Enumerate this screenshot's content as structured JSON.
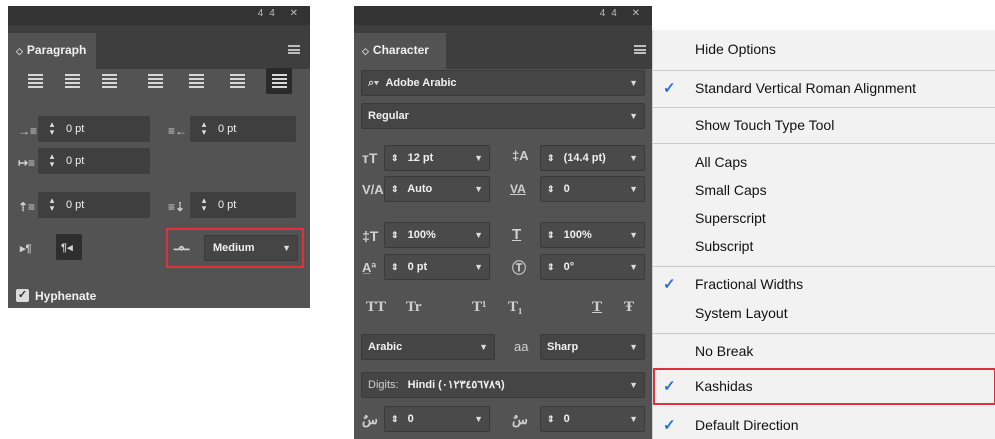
{
  "paragraph": {
    "title_controls": "44 ✕",
    "tab": "Paragraph",
    "left_indent": "0 pt",
    "right_indent": "0 pt",
    "first_line_indent": "0 pt",
    "space_before": "0 pt",
    "space_after": "0 pt",
    "kashida_value": "Medium",
    "hyphenate_label": "Hyphenate"
  },
  "character": {
    "title_controls": "44 ✕",
    "tab": "Character",
    "font_family": "Adobe Arabic",
    "font_style": "Regular",
    "font_size": "12 pt",
    "leading": "(14.4 pt)",
    "kerning": "Auto",
    "tracking": "0",
    "vertical_scale": "100%",
    "horizontal_scale": "100%",
    "baseline_shift": "0 pt",
    "rotation": "0°",
    "language": "Arabic",
    "aa_label": "aa",
    "antialias": "Sharp",
    "digits_label": "Digits:",
    "digits_value": "Hindi (٠١٢٣٤٥٦٧٨٩)",
    "diacritic_x": "0",
    "diacritic_y": "0",
    "case_buttons": [
      "TT",
      "Tr",
      "T¹",
      "T₁",
      "T",
      "Ŧ"
    ]
  },
  "menu": {
    "items": [
      {
        "label": "Hide Options",
        "checked": false
      },
      {
        "label": "Standard Vertical Roman Alignment",
        "checked": true
      },
      {
        "label": "Show Touch Type Tool",
        "checked": false
      },
      {
        "label": "All Caps",
        "checked": false
      },
      {
        "label": "Small Caps",
        "checked": false
      },
      {
        "label": "Superscript",
        "checked": false
      },
      {
        "label": "Subscript",
        "checked": false
      },
      {
        "label": "Fractional Widths",
        "checked": true
      },
      {
        "label": "System Layout",
        "checked": false
      },
      {
        "label": "No Break",
        "checked": false
      },
      {
        "label": "Kashidas",
        "checked": true
      },
      {
        "label": "Default Direction",
        "checked": true
      }
    ]
  },
  "icons": {
    "check": "✓",
    "hyphenate_check": "✓",
    "spinner": "⌃",
    "search": "⌕"
  },
  "colors": {
    "panel_bg": "#535353",
    "highlight_red": "#e0303a",
    "check_blue": "#2e6fd3"
  }
}
